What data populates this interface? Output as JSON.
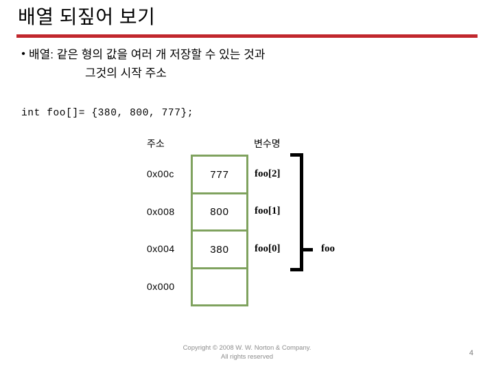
{
  "slide": {
    "title": "배열 되짚어 보기",
    "accent_color": "#C1272D",
    "box_border_color": "#7FA25E",
    "bullet_marker": "•",
    "bullet_lines": [
      "배열: 같은 형의 값을 여러 개 저장할 수 있는 것과",
      "그것의 시작 주소"
    ],
    "code": "int foo[]= {380, 800, 777};"
  },
  "diagram": {
    "headers": {
      "address": "주소",
      "variable_name": "변수명"
    },
    "rows": [
      {
        "address": "0x00c",
        "value": "777",
        "variable": "foo[2]"
      },
      {
        "address": "0x008",
        "value": "800",
        "variable": "foo[1]"
      },
      {
        "address": "0x004",
        "value": "380",
        "variable": "foo[0]"
      },
      {
        "address": "0x000",
        "value": "",
        "variable": ""
      }
    ],
    "brace_label": "foo"
  },
  "footer": {
    "copyright_line1": "Copyright © 2008 W. W. Norton & Company.",
    "copyright_line2": "All rights reserved",
    "page_number": "4"
  }
}
